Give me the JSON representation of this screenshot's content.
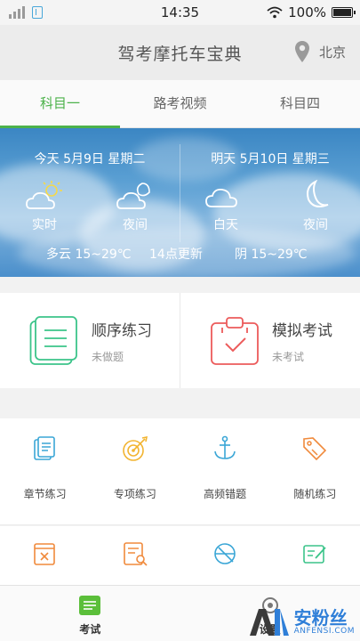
{
  "status_bar": {
    "time": "14:35",
    "battery": "100%"
  },
  "header": {
    "title": "驾考摩托车宝典",
    "city": "北京"
  },
  "tabs": [
    {
      "label": "科目一",
      "active": true
    },
    {
      "label": "路考视频",
      "active": false
    },
    {
      "label": "科目四",
      "active": false
    }
  ],
  "weather": {
    "today": {
      "date": "今天 5月9日 星期二",
      "day_label": "实时",
      "night_label": "夜间",
      "day_icon": "partly-cloudy-sun-icon",
      "night_icon": "cloudy-moon-icon"
    },
    "tomorrow": {
      "date": "明天 5月10日 星期三",
      "day_label": "白天",
      "night_label": "夜间",
      "day_icon": "cloud-icon",
      "night_icon": "moon-icon"
    },
    "today_summary": "多云 15~29℃",
    "update_time": "14点更新",
    "tomorrow_summary": "阴 15~29℃"
  },
  "practice": [
    {
      "title": "顺序练习",
      "subtitle": "未做题",
      "icon": "list-document-icon",
      "color": "#3cc48a"
    },
    {
      "title": "模拟考试",
      "subtitle": "未考试",
      "icon": "clipboard-check-icon",
      "color": "#ec5b5b"
    }
  ],
  "grid": [
    {
      "label": "章节练习",
      "icon": "chapter-book-icon",
      "color": "#3aa6d6"
    },
    {
      "label": "专项练习",
      "icon": "target-icon",
      "color": "#f2b431"
    },
    {
      "label": "高频错题",
      "icon": "anchor-icon",
      "color": "#3aa6d6"
    },
    {
      "label": "随机练习",
      "icon": "tag-icon",
      "color": "#f08a3c"
    }
  ],
  "grid2": [
    {
      "icon": "wrong-book-icon",
      "color": "#f08a3c"
    },
    {
      "icon": "search-document-icon",
      "color": "#f08a3c"
    },
    {
      "icon": "chart-circle-icon",
      "color": "#3aa6d6"
    },
    {
      "icon": "edit-note-icon",
      "color": "#3cc48a"
    }
  ],
  "bottom_nav": [
    {
      "label": "考试",
      "active": true,
      "icon": "exam-icon"
    },
    {
      "label": "设置",
      "active": false,
      "icon": "settings-icon"
    }
  ],
  "watermark": {
    "logo_text": "AN",
    "cn": "安粉丝",
    "en": "ANFENSI.COM"
  }
}
